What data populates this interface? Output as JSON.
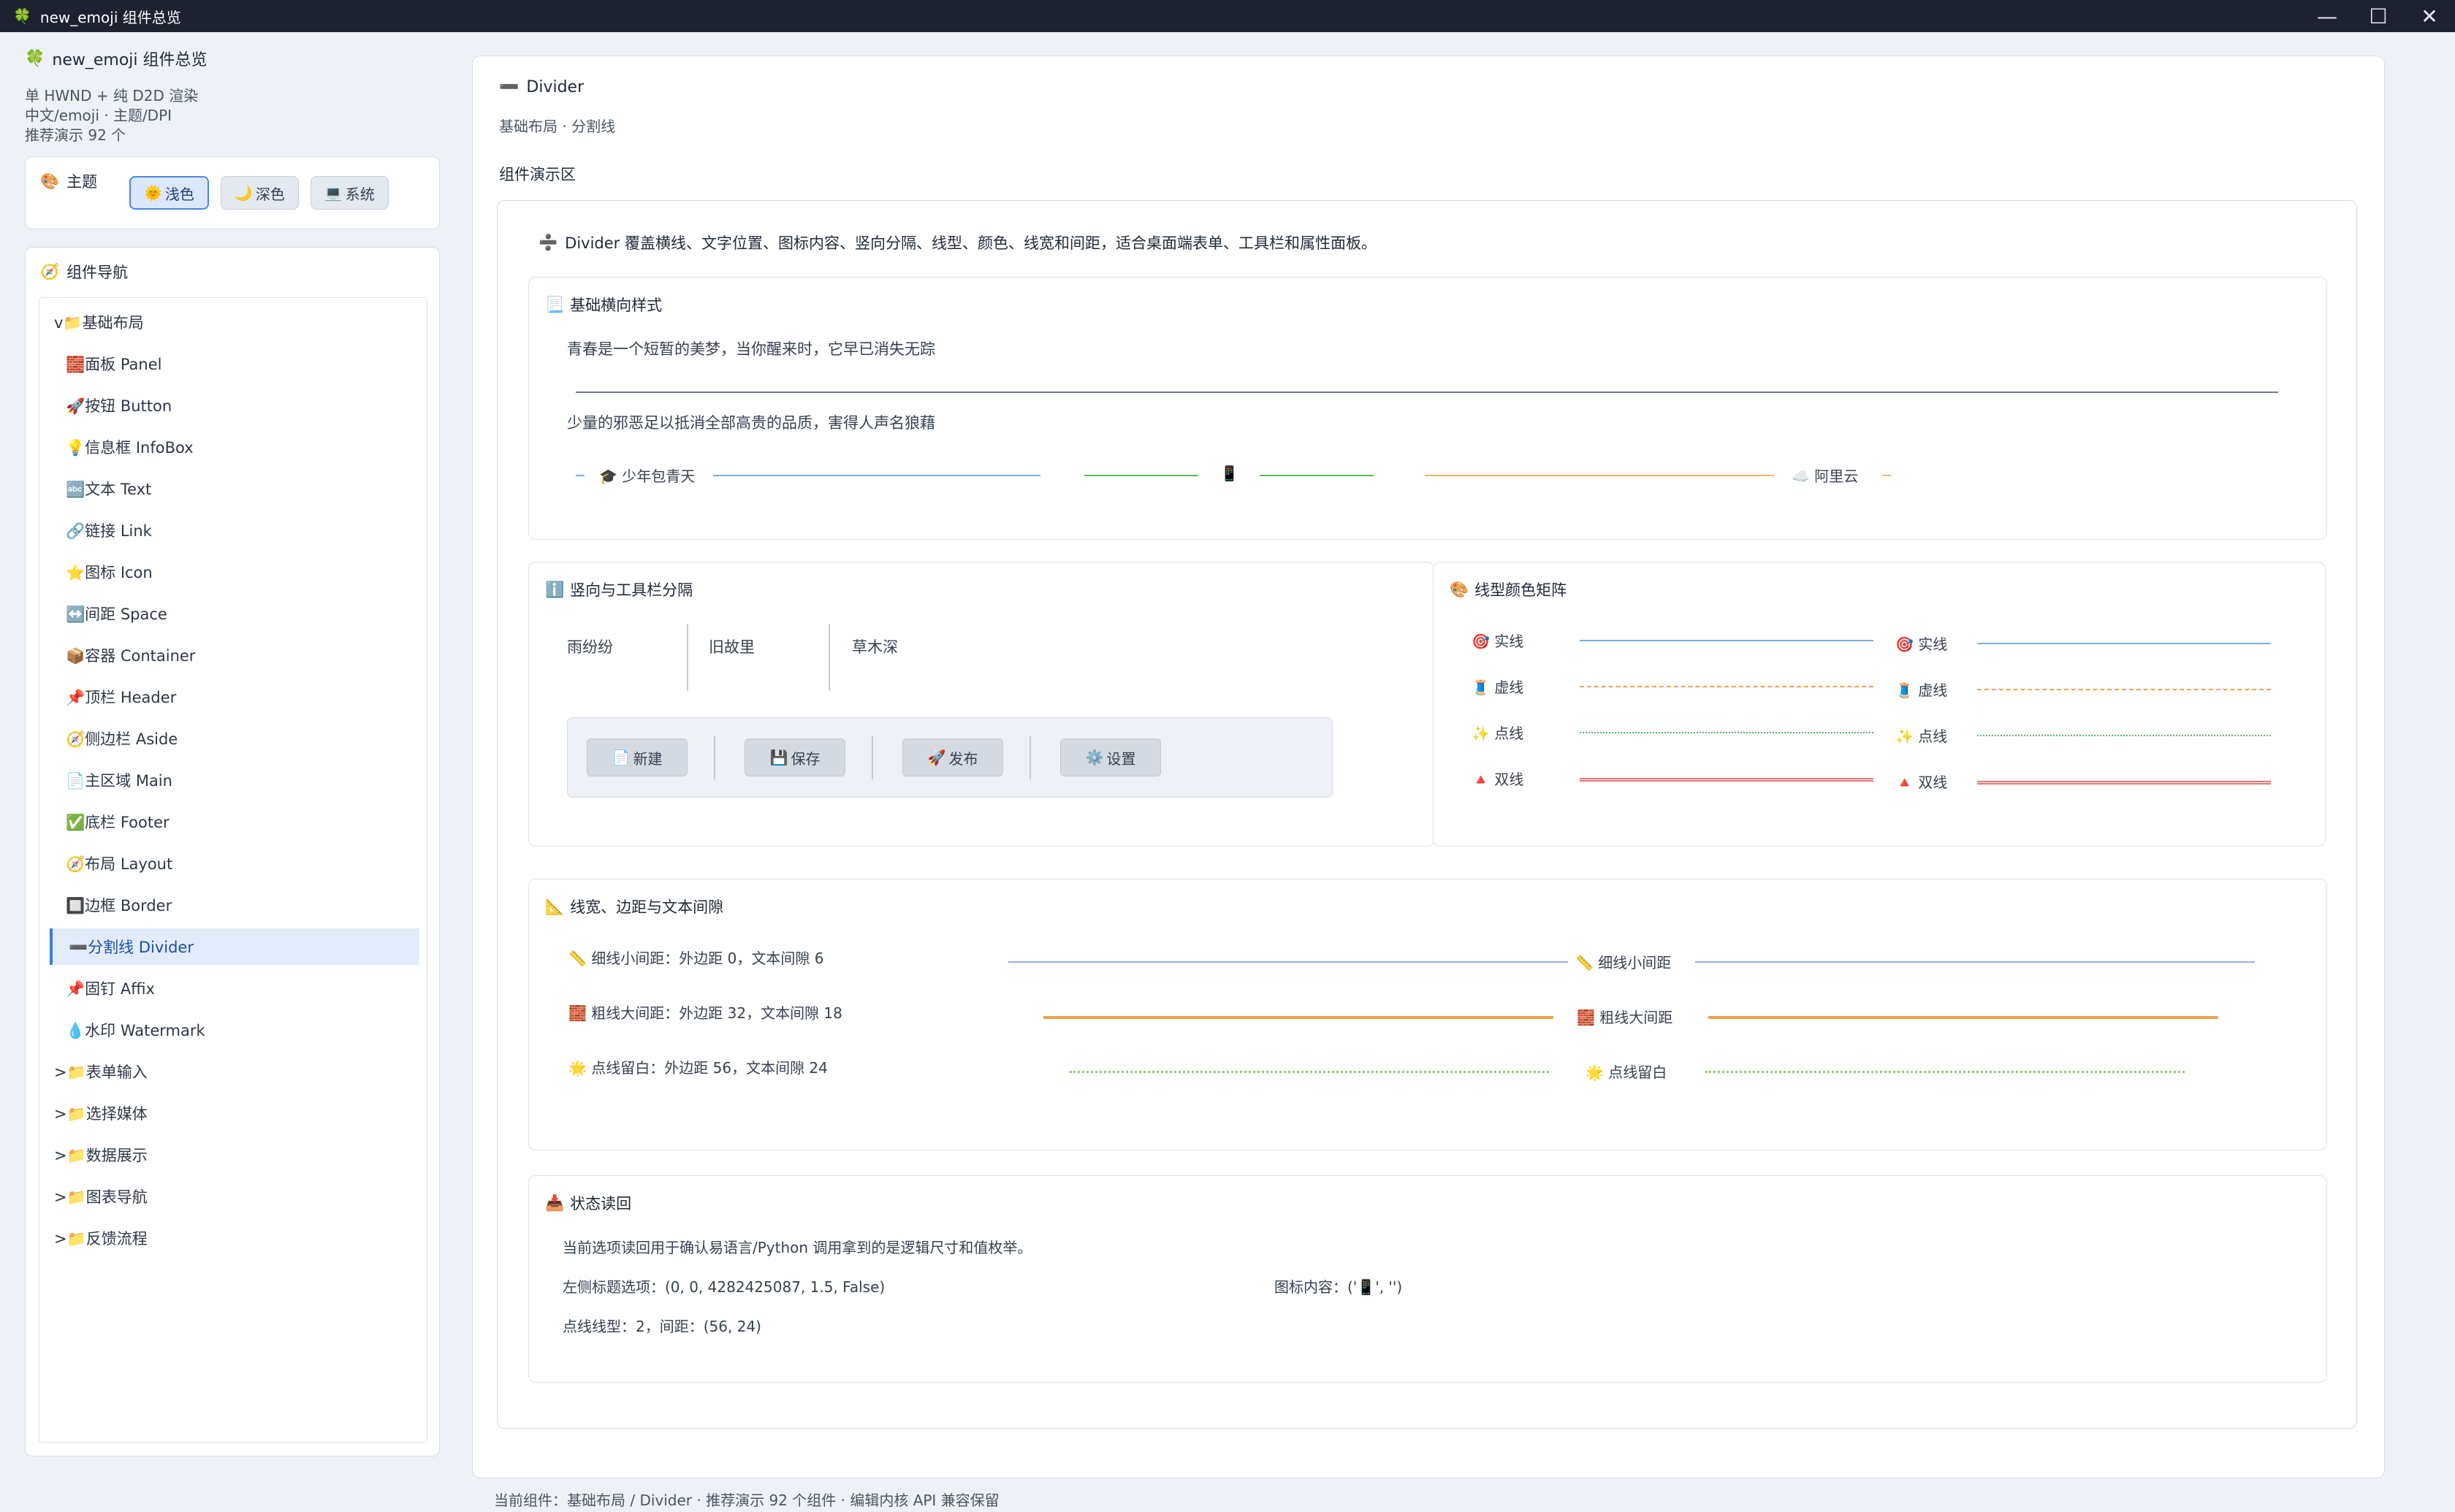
{
  "window": {
    "title": "new_emoji 组件总览",
    "icon": "🍀",
    "controls": [
      "—",
      "☐",
      "✕"
    ]
  },
  "sidebar": {
    "brand_icon": "🍀",
    "brand_title": "new_emoji 组件总览",
    "info_lines": [
      "单 HWND + 纯 D2D 渲染",
      "中文/emoji · 主题/DPI",
      "推荐演示 92 个"
    ],
    "theme": {
      "icon": "🎨",
      "label": "主题",
      "options": [
        {
          "icon": "🌞",
          "label": "浅色",
          "active": true
        },
        {
          "icon": "🌙",
          "label": "深色",
          "active": false
        },
        {
          "icon": "💻",
          "label": "系统",
          "active": false
        }
      ]
    },
    "nav": {
      "icon": "🧭",
      "label": "组件导航",
      "items": [
        {
          "label": "v📁基础布局",
          "type": "group"
        },
        {
          "label": "🧱面板 Panel",
          "type": "child"
        },
        {
          "label": "🚀按钮 Button",
          "type": "child"
        },
        {
          "label": "💡信息框 InfoBox",
          "type": "child"
        },
        {
          "label": "🔤文本 Text",
          "type": "child"
        },
        {
          "label": "🔗链接 Link",
          "type": "child"
        },
        {
          "label": "⭐图标 Icon",
          "type": "child"
        },
        {
          "label": "↔️间距 Space",
          "type": "child"
        },
        {
          "label": "📦容器 Container",
          "type": "child"
        },
        {
          "label": "📌顶栏 Header",
          "type": "child"
        },
        {
          "label": "🧭侧边栏 Aside",
          "type": "child"
        },
        {
          "label": "📄主区域 Main",
          "type": "child"
        },
        {
          "label": "✅底栏 Footer",
          "type": "child"
        },
        {
          "label": "🧭布局 Layout",
          "type": "child"
        },
        {
          "label": "🔲边框 Border",
          "type": "child"
        },
        {
          "label": "➖分割线 Divider",
          "type": "child",
          "selected": true
        },
        {
          "label": "📌固钉 Affix",
          "type": "child"
        },
        {
          "label": "💧水印 Watermark",
          "type": "child"
        },
        {
          "label": ">📁表单输入",
          "type": "group"
        },
        {
          "label": ">📁选择媒体",
          "type": "group"
        },
        {
          "label": ">📁数据展示",
          "type": "group"
        },
        {
          "label": ">📁图表导航",
          "type": "group"
        },
        {
          "label": ">📁反馈流程",
          "type": "group"
        }
      ]
    }
  },
  "main": {
    "title_icon": "➖",
    "title": "Divider",
    "subtitle": "基础布局 · 分割线",
    "demo_label": "组件演示区",
    "intro_icon": "➗",
    "intro": "Divider 覆盖横线、文字位置、图标内容、竖向分隔、线型、颜色、线宽和间距，适合桌面端表单、工具栏和属性面板。",
    "basic": {
      "icon": "📃",
      "title": "基础横向样式",
      "line1": "青春是一个短暂的美梦，当你醒来时，它早已消失无踪",
      "line2": "少量的邪恶足以抵消全部高贵的品质，害得人声名狼藉",
      "left_icon": "🎓",
      "left_text": "少年包青天",
      "center_icon": "📱",
      "right_icon": "☁️",
      "right_text": "阿里云"
    },
    "vertical": {
      "icon": "ℹ️",
      "title": "竖向与工具栏分隔",
      "words": [
        "雨纷纷",
        "旧故里",
        "草木深"
      ],
      "buttons": [
        {
          "icon": "📄",
          "label": "新建"
        },
        {
          "icon": "💾",
          "label": "保存"
        },
        {
          "icon": "🚀",
          "label": "发布"
        },
        {
          "icon": "⚙️",
          "label": "设置"
        }
      ]
    },
    "matrix": {
      "icon": "🎨",
      "title": "线型颜色矩阵",
      "rows": [
        {
          "icon": "🎯",
          "label": "实线",
          "style": "solid",
          "color": "#7aaee6"
        },
        {
          "icon": "🧵",
          "label": "虚线",
          "style": "dashed",
          "color": "#f0a24a"
        },
        {
          "icon": "✨",
          "label": "点线",
          "style": "dotted",
          "color": "#5bb85b"
        },
        {
          "icon": "🔺",
          "label": "双线",
          "style": "double",
          "color": "#e57373"
        }
      ]
    },
    "spacing": {
      "icon": "📐",
      "title": "线宽、边距与文本间隙",
      "rows": [
        {
          "icon": "📏",
          "label": "细线小间距：外边距 0，文本间隙 6",
          "short": "细线小间距",
          "color": "#8fb3e6"
        },
        {
          "icon": "🧱",
          "label": "粗线大间距：外边距 32，文本间隙 18",
          "short": "粗线大间距",
          "color": "#f0a24a"
        },
        {
          "icon": "🌟",
          "label": "点线留白：外边距 56，文本间隙 24",
          "short": "点线留白",
          "color": "#8ccf6a"
        }
      ]
    },
    "status": {
      "icon": "📥",
      "title": "状态读回",
      "line1": "当前选项读回用于确认易语言/Python 调用拿到的是逻辑尺寸和值枚举。",
      "line2": "左侧标题选项：(0, 0, 4282425087, 1.5, False)",
      "line2_right": "图标内容：('📱', '')",
      "line3": "点线线型：2，间距：(56, 24)"
    }
  },
  "statusbar": "当前组件：基础布局 / Divider · 推荐演示 92 个组件 · 编辑内核 API 兼容保留"
}
